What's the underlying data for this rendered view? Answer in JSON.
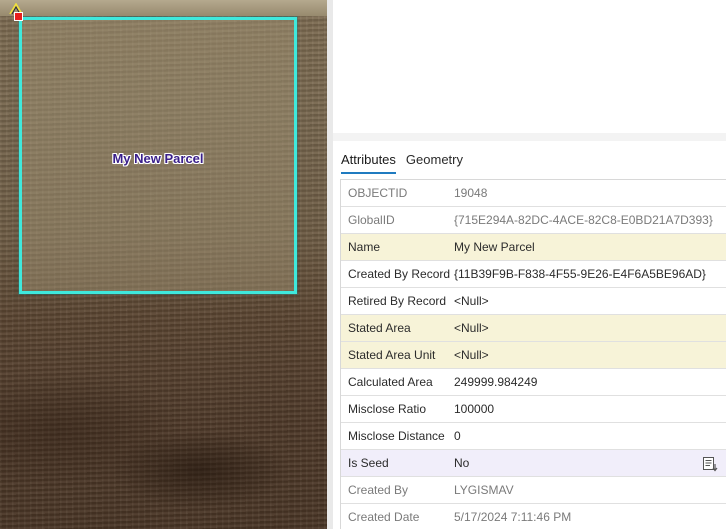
{
  "map": {
    "parcel_label": "My New Parcel"
  },
  "panel": {
    "tabs": [
      {
        "label": "Attributes",
        "active": true
      },
      {
        "label": "Geometry",
        "active": false
      }
    ],
    "rows": [
      {
        "field": "OBJECTID",
        "value": "19048",
        "state": "readonly"
      },
      {
        "field": "GlobalID",
        "value": "{715E294A-82DC-4ACE-82C8-E0BD21A7D393}",
        "state": "readonly"
      },
      {
        "field": "Name",
        "value": "My New Parcel",
        "state": "required"
      },
      {
        "field": "Created By Record",
        "value": "{11B39F9B-F838-4F55-9E26-E4F6A5BE96AD}",
        "state": "editable"
      },
      {
        "field": "Retired By Record",
        "value": "<Null>",
        "state": "editable"
      },
      {
        "field": "Stated Area",
        "value": "<Null>",
        "state": "required"
      },
      {
        "field": "Stated Area Unit",
        "value": "<Null>",
        "state": "required"
      },
      {
        "field": "Calculated Area",
        "value": "249999.984249",
        "state": "editable"
      },
      {
        "field": "Misclose Ratio",
        "value": "100000",
        "state": "editable"
      },
      {
        "field": "Misclose Distance",
        "value": "0",
        "state": "editable"
      },
      {
        "field": "Is Seed",
        "value": "No",
        "state": "selected",
        "icon": "field-options-icon"
      },
      {
        "field": "Created By",
        "value": "LYGISMAV",
        "state": "readonly"
      },
      {
        "field": "Created Date",
        "value": "5/17/2024 7:11:46 PM",
        "state": "readonly"
      }
    ]
  },
  "colors": {
    "parcel_outline": "#3fe8dc",
    "label_text": "#3a1f8a",
    "tab_underline": "#1f7bc0",
    "required_row": "#f7f3d8",
    "selected_row": "#f1eefa"
  }
}
